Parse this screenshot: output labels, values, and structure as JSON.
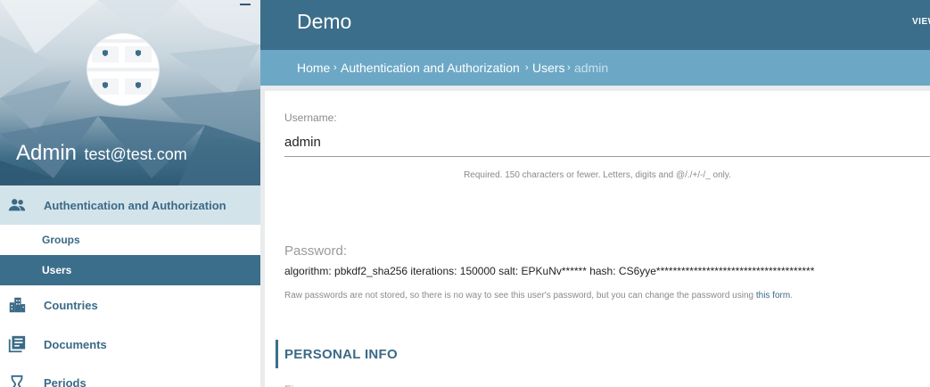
{
  "app": {
    "title": "Demo",
    "view_site": "VIEW SITE"
  },
  "user": {
    "name": "Admin",
    "email": "test@test.com"
  },
  "sidebar": {
    "items": [
      {
        "label": "Authentication and Authorization",
        "icon": "people-icon"
      },
      {
        "label": "Groups"
      },
      {
        "label": "Users"
      },
      {
        "label": "Countries",
        "icon": "building-icon"
      },
      {
        "label": "Documents",
        "icon": "documents-icon"
      },
      {
        "label": "Periods",
        "icon": "hourglass-icon"
      }
    ]
  },
  "breadcrumb": {
    "home": "Home",
    "auth": "Authentication and Authorization",
    "users": "Users",
    "current": "admin",
    "separator": "›"
  },
  "form": {
    "username_label": "Username:",
    "username_value": "admin",
    "username_help": "Required. 150 characters or fewer. Letters, digits and @/./+/-/_ only.",
    "password_label": "Password:",
    "password_value": "algorithm: pbkdf2_sha256 iterations: 150000 salt: EPKuNv****** hash: CS6yye**************************************",
    "password_help": "Raw passwords are not stored, so there is no way to see this user's password, but you can change the password using",
    "password_link": "this form",
    "password_help_end": ".",
    "section_title": "PERSONAL INFO",
    "next_label": "Fi"
  },
  "colors": {
    "primary": "#3b6e8b",
    "breadcrumb_bg": "#6ca8c6",
    "active_nav_bg": "#d3e3ea",
    "nav_text": "#3a6a87"
  }
}
